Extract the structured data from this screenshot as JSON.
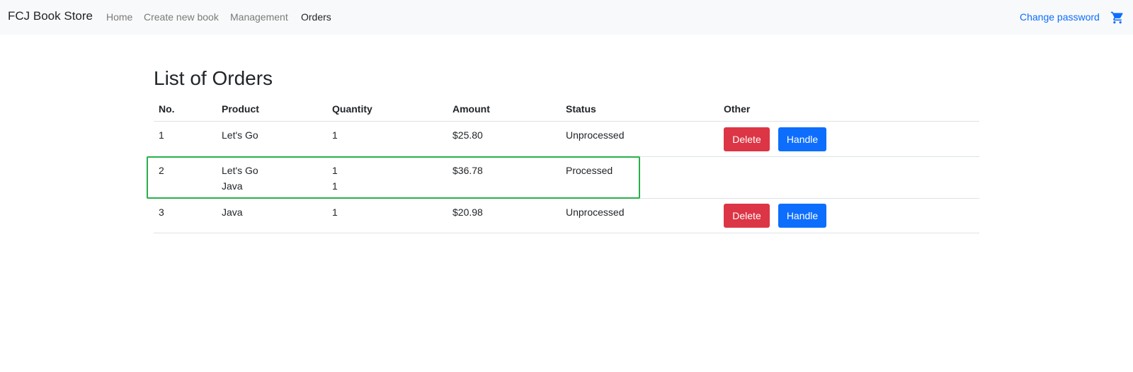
{
  "nav": {
    "brand": "FCJ Book Store",
    "links": [
      "Home",
      "Create new book",
      "Management",
      "Orders"
    ],
    "right_link": "Change password",
    "cart_icon": "cart-icon"
  },
  "page": {
    "title": "List of Orders"
  },
  "table": {
    "headers": [
      "No.",
      "Product",
      "Quantity",
      "Amount",
      "Status",
      "Other"
    ],
    "rows": [
      {
        "no": "1",
        "products": [
          "Let's Go"
        ],
        "quantities": [
          "1"
        ],
        "amount": "$25.80",
        "status": "Unprocessed",
        "actions": [
          "Delete",
          "Handle"
        ]
      },
      {
        "no": "2",
        "products": [
          "Let's Go",
          "Java"
        ],
        "quantities": [
          "1",
          "1"
        ],
        "amount": "$36.78",
        "status": "Processed",
        "actions": []
      },
      {
        "no": "3",
        "products": [
          "Java"
        ],
        "quantities": [
          "1"
        ],
        "amount": "$20.98",
        "status": "Unprocessed",
        "actions": [
          "Delete",
          "Handle"
        ]
      }
    ]
  },
  "colors": {
    "danger": "#dc3545",
    "primary": "#0d6efd",
    "highlight": "#28b04a"
  }
}
